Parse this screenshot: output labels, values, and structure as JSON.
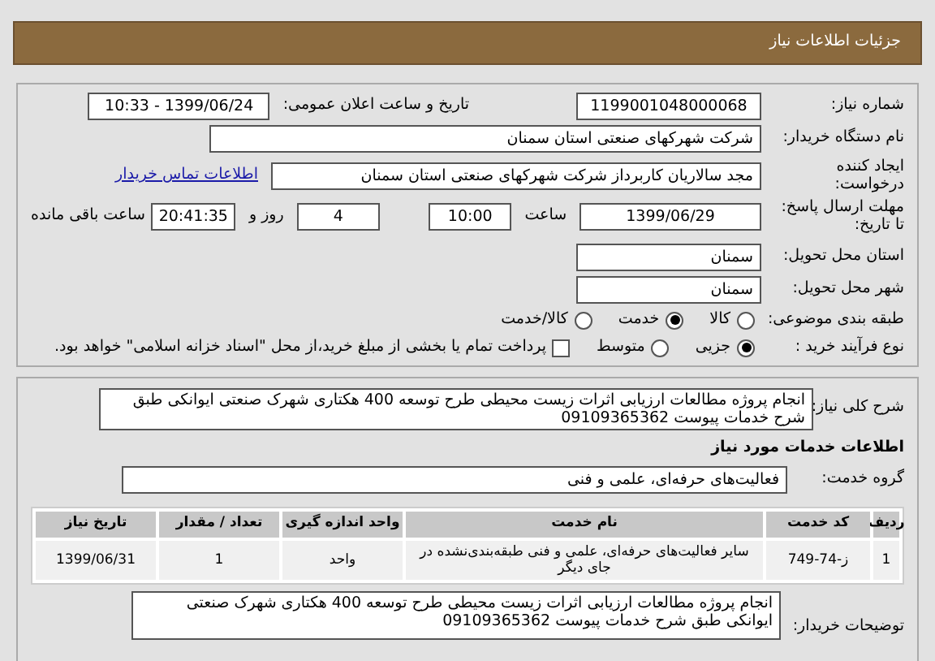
{
  "header": {
    "title": "جزئیات اطلاعات نیاز"
  },
  "need_number": {
    "label": "شماره نیاز:",
    "value": "1199001048000068"
  },
  "announce": {
    "label": "تاریخ و ساعت اعلان عمومی:",
    "value": "1399/06/24 - 10:33"
  },
  "buyer": {
    "label": "نام دستگاه خریدار:",
    "value": "شرکت شهرکهای صنعتی استان سمنان"
  },
  "creator": {
    "label_1": "ایجاد کننده",
    "label_2": "درخواست:",
    "value": "مجد سالاریان کاربرداز شرکت شهرکهای صنعتی استان سمنان",
    "link": "اطلاعات تماس خریدار"
  },
  "deadline": {
    "label_1": "مهلت ارسال پاسخ:",
    "label_2": "تا تاریخ:",
    "date": "1399/06/29",
    "time_label": "ساعت",
    "time": "10:00",
    "days": "4",
    "days_label": "روز و",
    "remaining": "20:41:35",
    "remaining_label": "ساعت باقی مانده"
  },
  "province": {
    "label": "استان محل تحویل:",
    "value": "سمنان"
  },
  "city": {
    "label": "شهر محل تحویل:",
    "value": "سمنان"
  },
  "category": {
    "label": "طبقه بندی موضوعی:",
    "options": [
      {
        "label": "کالا",
        "selected": false
      },
      {
        "label": "خدمت",
        "selected": true
      },
      {
        "label": "کالا/خدمت",
        "selected": false
      }
    ]
  },
  "purchase_type": {
    "label": "نوع فرآیند خرید :",
    "options": [
      {
        "label": "جزیی",
        "selected": true
      },
      {
        "label": "متوسط",
        "selected": false
      }
    ],
    "payment": {
      "label": "پرداخت تمام یا بخشی از مبلغ خرید،از محل \"اسناد خزانه اسلامی\" خواهد بود.",
      "checked": false
    }
  },
  "description": {
    "label": "شرح کلی نیاز:",
    "value": "انجام پروژه مطالعات ارزیابی اثرات زیست محیطی طرح توسعه 400 هکتاری شهرک صنعتی ایوانکی طبق شرح خدمات پیوست 09109365362"
  },
  "services_heading": "اطلاعات خدمات مورد نیاز",
  "service_group": {
    "label": "گروه خدمت:",
    "value": "فعالیت‌های حرفه‌ای، علمی و فنی"
  },
  "table": {
    "columns": [
      "ردیف",
      "کد خدمت",
      "نام خدمت",
      "واحد اندازه گیری",
      "تعداد / مقدار",
      "تاریخ نیاز"
    ],
    "rows": [
      [
        "1",
        "ز-74-749",
        "سایر فعالیت‌های حرفه‌ای، علمی و فنی طبقه‌بندی‌نشده در جای دیگر",
        "واحد",
        "1",
        "1399/06/31"
      ]
    ]
  },
  "buyer_notes": {
    "label": "توضیحات خریدار:",
    "value": "انجام پروژه مطالعات ارزیابی اثرات زیست محیطی طرح توسعه 400 هکتاری شهرک صنعتی ایوانکی طبق شرح خدمات پیوست 09109365362"
  }
}
